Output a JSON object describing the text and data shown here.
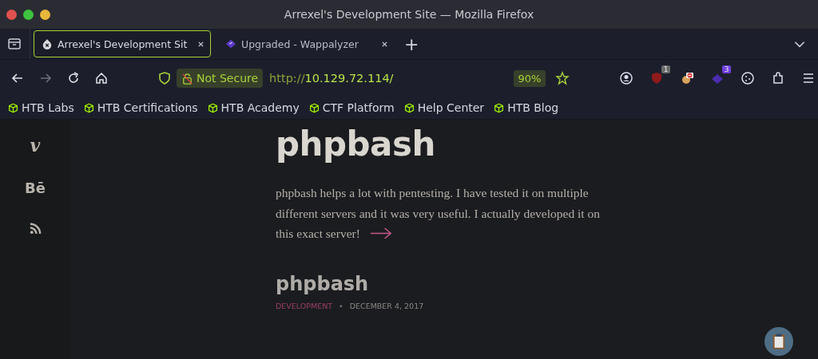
{
  "window": {
    "title": "Arrexel's Development Site — Mozilla Firefox"
  },
  "tabs": [
    {
      "label": "Arrexel's Development Sit",
      "selected": true,
      "kind": "site"
    },
    {
      "label": "Upgraded - Wappalyzer",
      "selected": false,
      "kind": "wappalyzer"
    }
  ],
  "new_tab": "+",
  "address_bar": {
    "security": "Not Secure",
    "url_scheme": "http://",
    "url_host": "10.129.72.114/",
    "zoom": "90%"
  },
  "extensions": [
    {
      "kind": "account"
    },
    {
      "kind": "shield",
      "badge": "1"
    },
    {
      "kind": "blocker"
    },
    {
      "kind": "wappalyzer",
      "badge": "3"
    },
    {
      "kind": "cookie"
    },
    {
      "kind": "puzzle"
    },
    {
      "kind": "menu"
    }
  ],
  "bookmarks": [
    {
      "label": "HTB Labs"
    },
    {
      "label": "HTB Certifications"
    },
    {
      "label": "HTB Academy"
    },
    {
      "label": "CTF Platform"
    },
    {
      "label": "Help Center"
    },
    {
      "label": "HTB Blog"
    }
  ],
  "sidebar": [
    {
      "kind": "glyph",
      "label": "v"
    },
    {
      "kind": "glyph",
      "label": "Bē"
    },
    {
      "kind": "rss"
    }
  ],
  "page": {
    "heading": "phpbash",
    "excerpt_lines": [
      "phpbash helps a lot with pentesting. I have tested it on multiple",
      "different servers and it was very useful. I actually developed it on",
      "this exact server!"
    ],
    "post": {
      "title": "phpbash",
      "category": "DEVELOPMENT",
      "separator": "•",
      "date": "DECEMBER 4, 2017"
    }
  }
}
